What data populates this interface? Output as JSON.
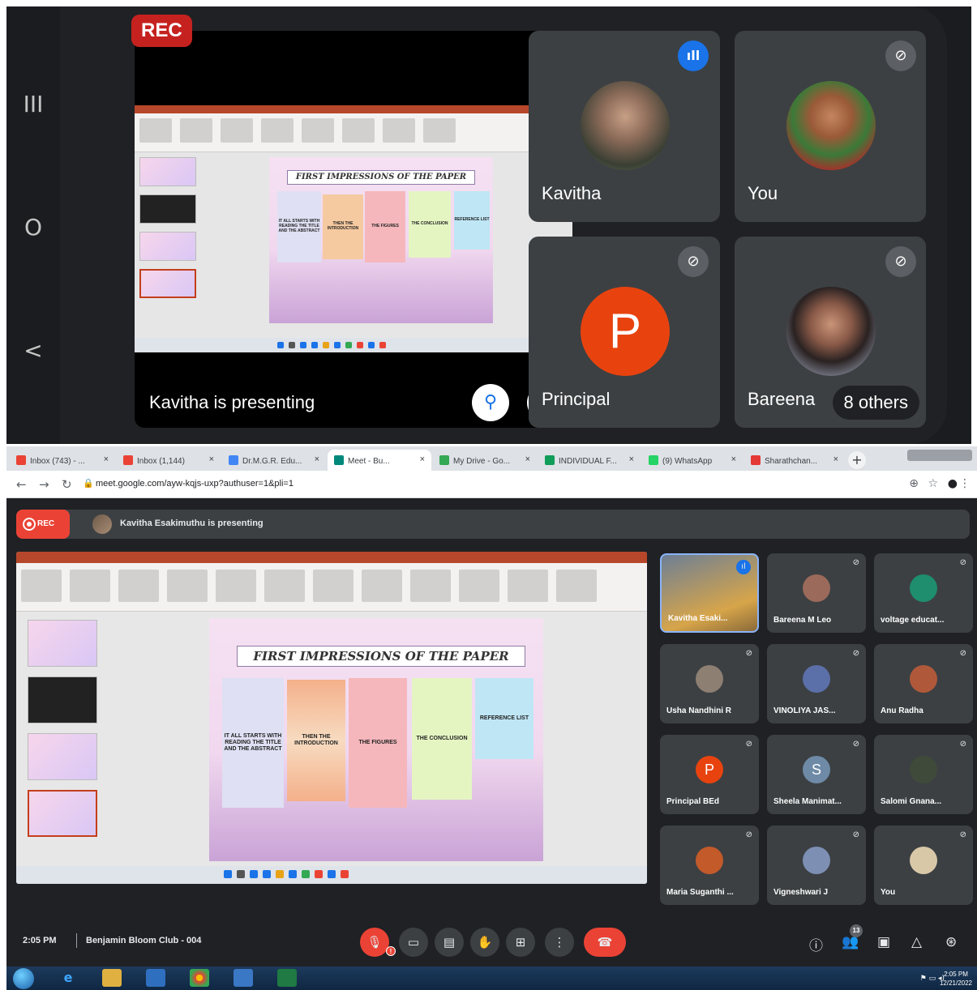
{
  "phone": {
    "rec_label": "REC",
    "presenting_caption": "Kavitha is presenting",
    "nav": {
      "recents_icon": "III",
      "home_icon": "O",
      "back_icon": "<"
    },
    "tiles": [
      {
        "name": "Kavitha",
        "speaking": true
      },
      {
        "name": "You",
        "muted": true
      },
      {
        "name": "Principal",
        "initial": "P",
        "muted": true
      },
      {
        "name": "Bareena",
        "muted": true,
        "others_label": "8 others"
      }
    ],
    "slide": {
      "title": "FIRST IMPRESSIONS OF THE PAPER",
      "cards": [
        {
          "text": "IT ALL STARTS WITH READING THE TITLE AND THE ABSTRACT",
          "color": "#dfe0f3"
        },
        {
          "text": "THEN THE INTRODUCTION",
          "color": "#f6caa0"
        },
        {
          "text": "THE FIGURES",
          "color": "#f5b7bc"
        },
        {
          "text": "THE CONCLUSION",
          "color": "#e4f5c2"
        },
        {
          "text": "REFERENCE LIST",
          "color": "#bfe6f5"
        }
      ]
    }
  },
  "browser": {
    "tabs": [
      {
        "label": "Inbox (743) - ...",
        "fav": "#ea4335",
        "active": false
      },
      {
        "label": "Inbox (1,144)",
        "fav": "#ea4335",
        "active": false
      },
      {
        "label": "Dr.M.G.R. Edu...",
        "fav": "#4285f4",
        "active": false
      },
      {
        "label": "Meet - Bu...",
        "fav": "#00897b",
        "active": true
      },
      {
        "label": "My Drive - Go...",
        "fav": "#34a853",
        "active": false
      },
      {
        "label": "INDIVIDUAL F...",
        "fav": "#0f9d58",
        "active": false
      },
      {
        "label": "(9) WhatsApp",
        "fav": "#25d366",
        "active": false
      },
      {
        "label": "Sharathchan...",
        "fav": "#e53935",
        "active": false
      }
    ],
    "url": "meet.google.com/ayw-kqjs-uxp?authuser=1&pli=1"
  },
  "meet": {
    "rec_label": "REC",
    "presenting_text": "Kavitha Esakimuthu is presenting",
    "slide": {
      "title": "FIRST IMPRESSIONS OF THE PAPER",
      "cards": [
        {
          "text": "IT ALL STARTS WITH READING THE TITLE AND THE ABSTRACT",
          "color": "#dfe0f3"
        },
        {
          "text": "THEN THE INTRODUCTION",
          "color": "#f6caa0"
        },
        {
          "text": "THE FIGURES",
          "color": "#f5b7bc"
        },
        {
          "text": "THE CONCLUSION",
          "color": "#e4f5c2"
        },
        {
          "text": "REFERENCE LIST",
          "color": "#bfe6f5"
        }
      ]
    },
    "participants": [
      {
        "name": "Kavitha Esaki...",
        "kind": "video",
        "speaking": true
      },
      {
        "name": "Bareena M Leo",
        "kind": "photo",
        "color": "#9b6a5a"
      },
      {
        "name": "voltage educat...",
        "kind": "photo",
        "color": "#1e8e6e"
      },
      {
        "name": "Usha Nandhini R",
        "kind": "photo",
        "color": "#8d7f72"
      },
      {
        "name": "VINOLIYA JAS...",
        "kind": "photo",
        "color": "#5b6fa8"
      },
      {
        "name": "Anu Radha",
        "kind": "photo",
        "color": "#b0593a"
      },
      {
        "name": "Principal BEd",
        "kind": "letter",
        "initial": "P",
        "color": "#e8430f"
      },
      {
        "name": "Sheela Manimat...",
        "kind": "letter",
        "initial": "S",
        "color": "#6e8aa6"
      },
      {
        "name": "Salomi Gnana...",
        "kind": "photo",
        "color": "#3f4a3a"
      },
      {
        "name": "Maria Suganthi ...",
        "kind": "photo",
        "color": "#c25a2a"
      },
      {
        "name": "Vigneshwari J",
        "kind": "photo",
        "color": "#7d8fb3"
      },
      {
        "name": "You",
        "kind": "photo",
        "color": "#d9c8a8"
      }
    ],
    "time": "2:05 PM",
    "meeting_name": "Benjamin Bloom Club - 004",
    "people_count": "13",
    "mic_badge": "!"
  },
  "windows": {
    "time": "2:05 PM",
    "date": "12/21/2022"
  }
}
